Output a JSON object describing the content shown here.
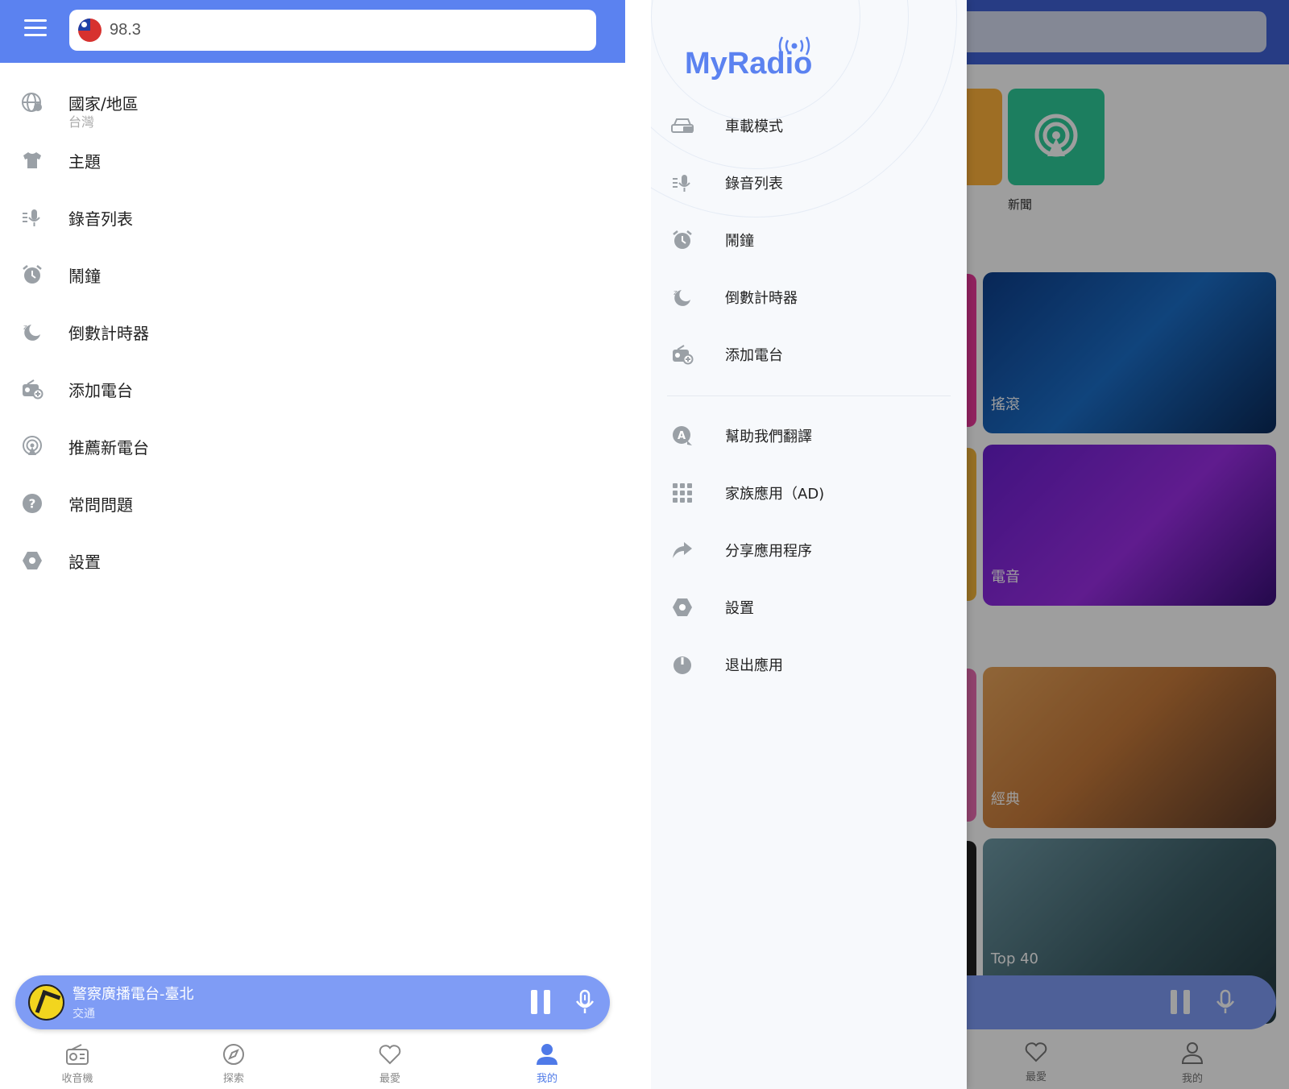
{
  "left": {
    "search": {
      "value": "98.3"
    },
    "menu": [
      {
        "label": "國家/地區",
        "sub": "台灣",
        "icon": "globe-icon"
      },
      {
        "label": "主題",
        "icon": "tshirt-icon"
      },
      {
        "label": "錄音列表",
        "icon": "recording-list-icon"
      },
      {
        "label": "鬧鐘",
        "icon": "alarm-clock-icon"
      },
      {
        "label": "倒數計時器",
        "icon": "sleep-timer-icon"
      },
      {
        "label": "添加電台",
        "icon": "add-radio-icon"
      },
      {
        "label": "推薦新電台",
        "icon": "broadcast-icon"
      },
      {
        "label": "常問問題",
        "icon": "help-icon"
      },
      {
        "label": "設置",
        "icon": "settings-icon"
      }
    ],
    "player": {
      "title": "警察廣播電台-臺北",
      "subtitle": "交通"
    },
    "nav": [
      {
        "label": "收音機",
        "icon": "radio-icon"
      },
      {
        "label": "探索",
        "icon": "compass-icon"
      },
      {
        "label": "最愛",
        "icon": "heart-icon"
      },
      {
        "label": "我的",
        "icon": "person-icon"
      }
    ]
  },
  "right": {
    "brand": "MyRadio",
    "drawer": [
      {
        "label": "車載模式",
        "icon": "car-icon"
      },
      {
        "label": "錄音列表",
        "icon": "recording-list-icon"
      },
      {
        "label": "鬧鐘",
        "icon": "alarm-clock-icon"
      },
      {
        "label": "倒數計時器",
        "icon": "sleep-timer-icon"
      },
      {
        "label": "添加電台",
        "icon": "add-radio-icon"
      },
      {
        "label": "幫助我們翻譯",
        "icon": "translate-icon"
      },
      {
        "label": "家族應用（AD)",
        "icon": "app-grid-icon"
      },
      {
        "label": "分享應用程序",
        "icon": "share-icon"
      },
      {
        "label": "設置",
        "icon": "settings-icon"
      },
      {
        "label": "退出應用",
        "icon": "power-icon"
      }
    ],
    "background": {
      "news_label": "新聞",
      "genres": [
        "搖滾",
        "電音",
        "經典",
        "Top 40"
      ],
      "nav": [
        {
          "label": "最愛"
        },
        {
          "label": "我的"
        }
      ]
    }
  },
  "colors": {
    "accent": "#5b82f0",
    "player": "#7f9cf5",
    "icon_grey": "#9aa0a6",
    "active_tab": "#4f7ae8"
  }
}
